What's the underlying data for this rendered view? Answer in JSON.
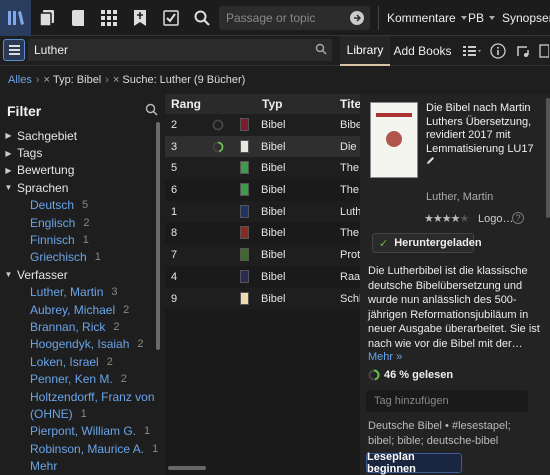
{
  "toolbar": {
    "icons": [
      "library-icon",
      "documents-icon",
      "book-icon",
      "grid-icon",
      "bookmark-icon",
      "checklist-icon",
      "search-icon"
    ],
    "passage_placeholder": "Passage or topic",
    "menus": [
      {
        "label": "Kommentare"
      },
      {
        "label": "PB"
      },
      {
        "label": "Synopsen"
      }
    ]
  },
  "library_bar": {
    "search_value": "Luther",
    "tab_library": "Library",
    "tab_add_books": "Add Books"
  },
  "breadcrumb": {
    "root": "Alles",
    "filter_type": "Typ: Bibel",
    "filter_search": "Suche: Luther (9 Bücher)"
  },
  "filter": {
    "title": "Filter",
    "groups": [
      {
        "label": "Sachgebiet",
        "expanded": false
      },
      {
        "label": "Tags",
        "expanded": false
      },
      {
        "label": "Bewertung",
        "expanded": false
      },
      {
        "label": "Sprachen",
        "expanded": true
      },
      {
        "label": "Verfasser",
        "expanded": true
      }
    ],
    "languages": [
      {
        "label": "Deutsch",
        "count": "5"
      },
      {
        "label": "Englisch",
        "count": "2"
      },
      {
        "label": "Finnisch",
        "count": "1"
      },
      {
        "label": "Griechisch",
        "count": "1"
      }
    ],
    "authors": [
      {
        "label": "Luther, Martin",
        "count": "3"
      },
      {
        "label": "Aubrey, Michael",
        "count": "2"
      },
      {
        "label": "Brannan, Rick",
        "count": "2"
      },
      {
        "label": "Hoogendyk, Isaiah",
        "count": "2"
      },
      {
        "label": "Loken, Israel",
        "count": "2"
      },
      {
        "label": "Penner, Ken M.",
        "count": "2"
      },
      {
        "label": "Holtzendorff, Franz von",
        "count": "1"
      },
      {
        "label": "(OHNE)",
        "count": "1"
      },
      {
        "label": "Pierpont, William G.",
        "count": "1"
      },
      {
        "label": "Robinson, Maurice A.",
        "count": "1"
      },
      {
        "label": "Mehr",
        "count": ""
      }
    ]
  },
  "table": {
    "headers": {
      "rank": "Rang",
      "type": "Typ",
      "title": "Titel"
    },
    "rows": [
      {
        "rank": "2",
        "type": "Bibel",
        "title": "Bibel",
        "cover": "#7a1c2e"
      },
      {
        "rank": "3",
        "type": "Bibel",
        "title": "Die B",
        "cover": "#e8e8e0"
      },
      {
        "rank": "5",
        "type": "Bibel",
        "title": "The",
        "cover": "#3e9b4a"
      },
      {
        "rank": "6",
        "type": "Bibel",
        "title": "The",
        "cover": "#3e9b4a"
      },
      {
        "rank": "1",
        "type": "Bibel",
        "title": "Luth",
        "cover": "#1f3466"
      },
      {
        "rank": "8",
        "type": "Bibel",
        "title": "The",
        "cover": "#8a2a20"
      },
      {
        "rank": "7",
        "type": "Bibel",
        "title": "Proto",
        "cover": "#3b6a2a"
      },
      {
        "rank": "4",
        "type": "Bibel",
        "title": "Raan",
        "cover": "#2a2a55"
      },
      {
        "rank": "9",
        "type": "Bibel",
        "title": "Schl",
        "cover": "#f1d9b0"
      }
    ]
  },
  "detail": {
    "title": "Die Bibel nach Martin Luthers Übersetzung, revidiert 2017 mit Lemmatisierung LU17",
    "author": "Luther, Martin",
    "rating": 4,
    "logo_text": "Logo…",
    "downloaded_label": "Heruntergeladen",
    "description": "Die Lutherbibel ist die klassische deutsche Bibelübersetzung und wurde nun anlässlich des 500-jährigen Reformationsjubiläum in neuer Ausgabe überarbeitet. Sie ist nach wie vor die Bibel mit der…",
    "more": "Mehr »",
    "progress_percent": 46,
    "progress_label": "46 % gelesen",
    "tag_placeholder": "Tag hinzufügen",
    "tags": "Deutsche Bibel • #lesestapel; bibel; bible; deutsche-bibel",
    "plan_button": "Leseplan beginnen"
  },
  "colors": {
    "accent_link": "#6aa5ea",
    "progress_green": "#6bbf4a",
    "tab_underline": "#d8c4a4"
  }
}
